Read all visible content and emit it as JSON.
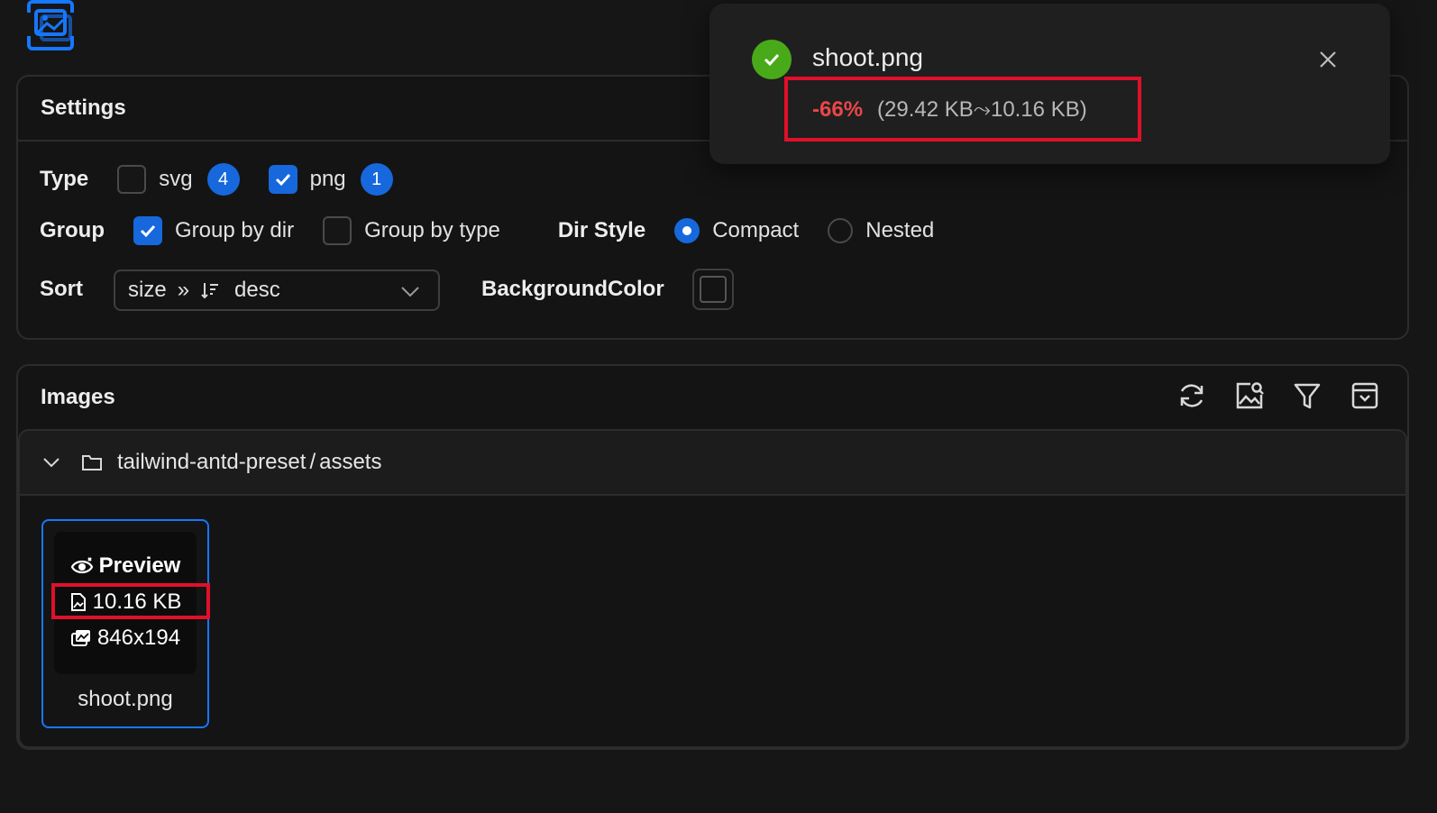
{
  "settings": {
    "title": "Settings",
    "type": {
      "label": "Type",
      "options": [
        {
          "label": "svg",
          "checked": false,
          "count": "4"
        },
        {
          "label": "png",
          "checked": true,
          "count": "1"
        }
      ]
    },
    "group": {
      "label": "Group",
      "options": [
        {
          "label": "Group by dir",
          "checked": true
        },
        {
          "label": "Group by type",
          "checked": false
        }
      ]
    },
    "dir_style": {
      "label": "Dir Style",
      "options": [
        {
          "label": "Compact",
          "selected": true
        },
        {
          "label": "Nested",
          "selected": false
        }
      ]
    },
    "sort": {
      "label": "Sort",
      "field": "size",
      "separator": "»",
      "order": "desc"
    },
    "background_color": {
      "label": "BackgroundColor"
    }
  },
  "images": {
    "title": "Images",
    "group": {
      "path_prefix": "tailwind-antd-preset",
      "path_sep": "/",
      "path_suffix": "assets",
      "expanded": true
    },
    "items": [
      {
        "name": "shoot.png",
        "preview_label": "Preview",
        "size": "10.16 KB",
        "dimensions": "846x194"
      }
    ]
  },
  "notification": {
    "status": "success",
    "title": "shoot.png",
    "percent": "-66%",
    "sizes_text": "(29.42 KB⤳10.16 KB)"
  },
  "colors": {
    "accent": "#1668dc",
    "success": "#49aa19",
    "danger": "#e84749",
    "highlight": "#e0102a",
    "background": "#161616"
  }
}
